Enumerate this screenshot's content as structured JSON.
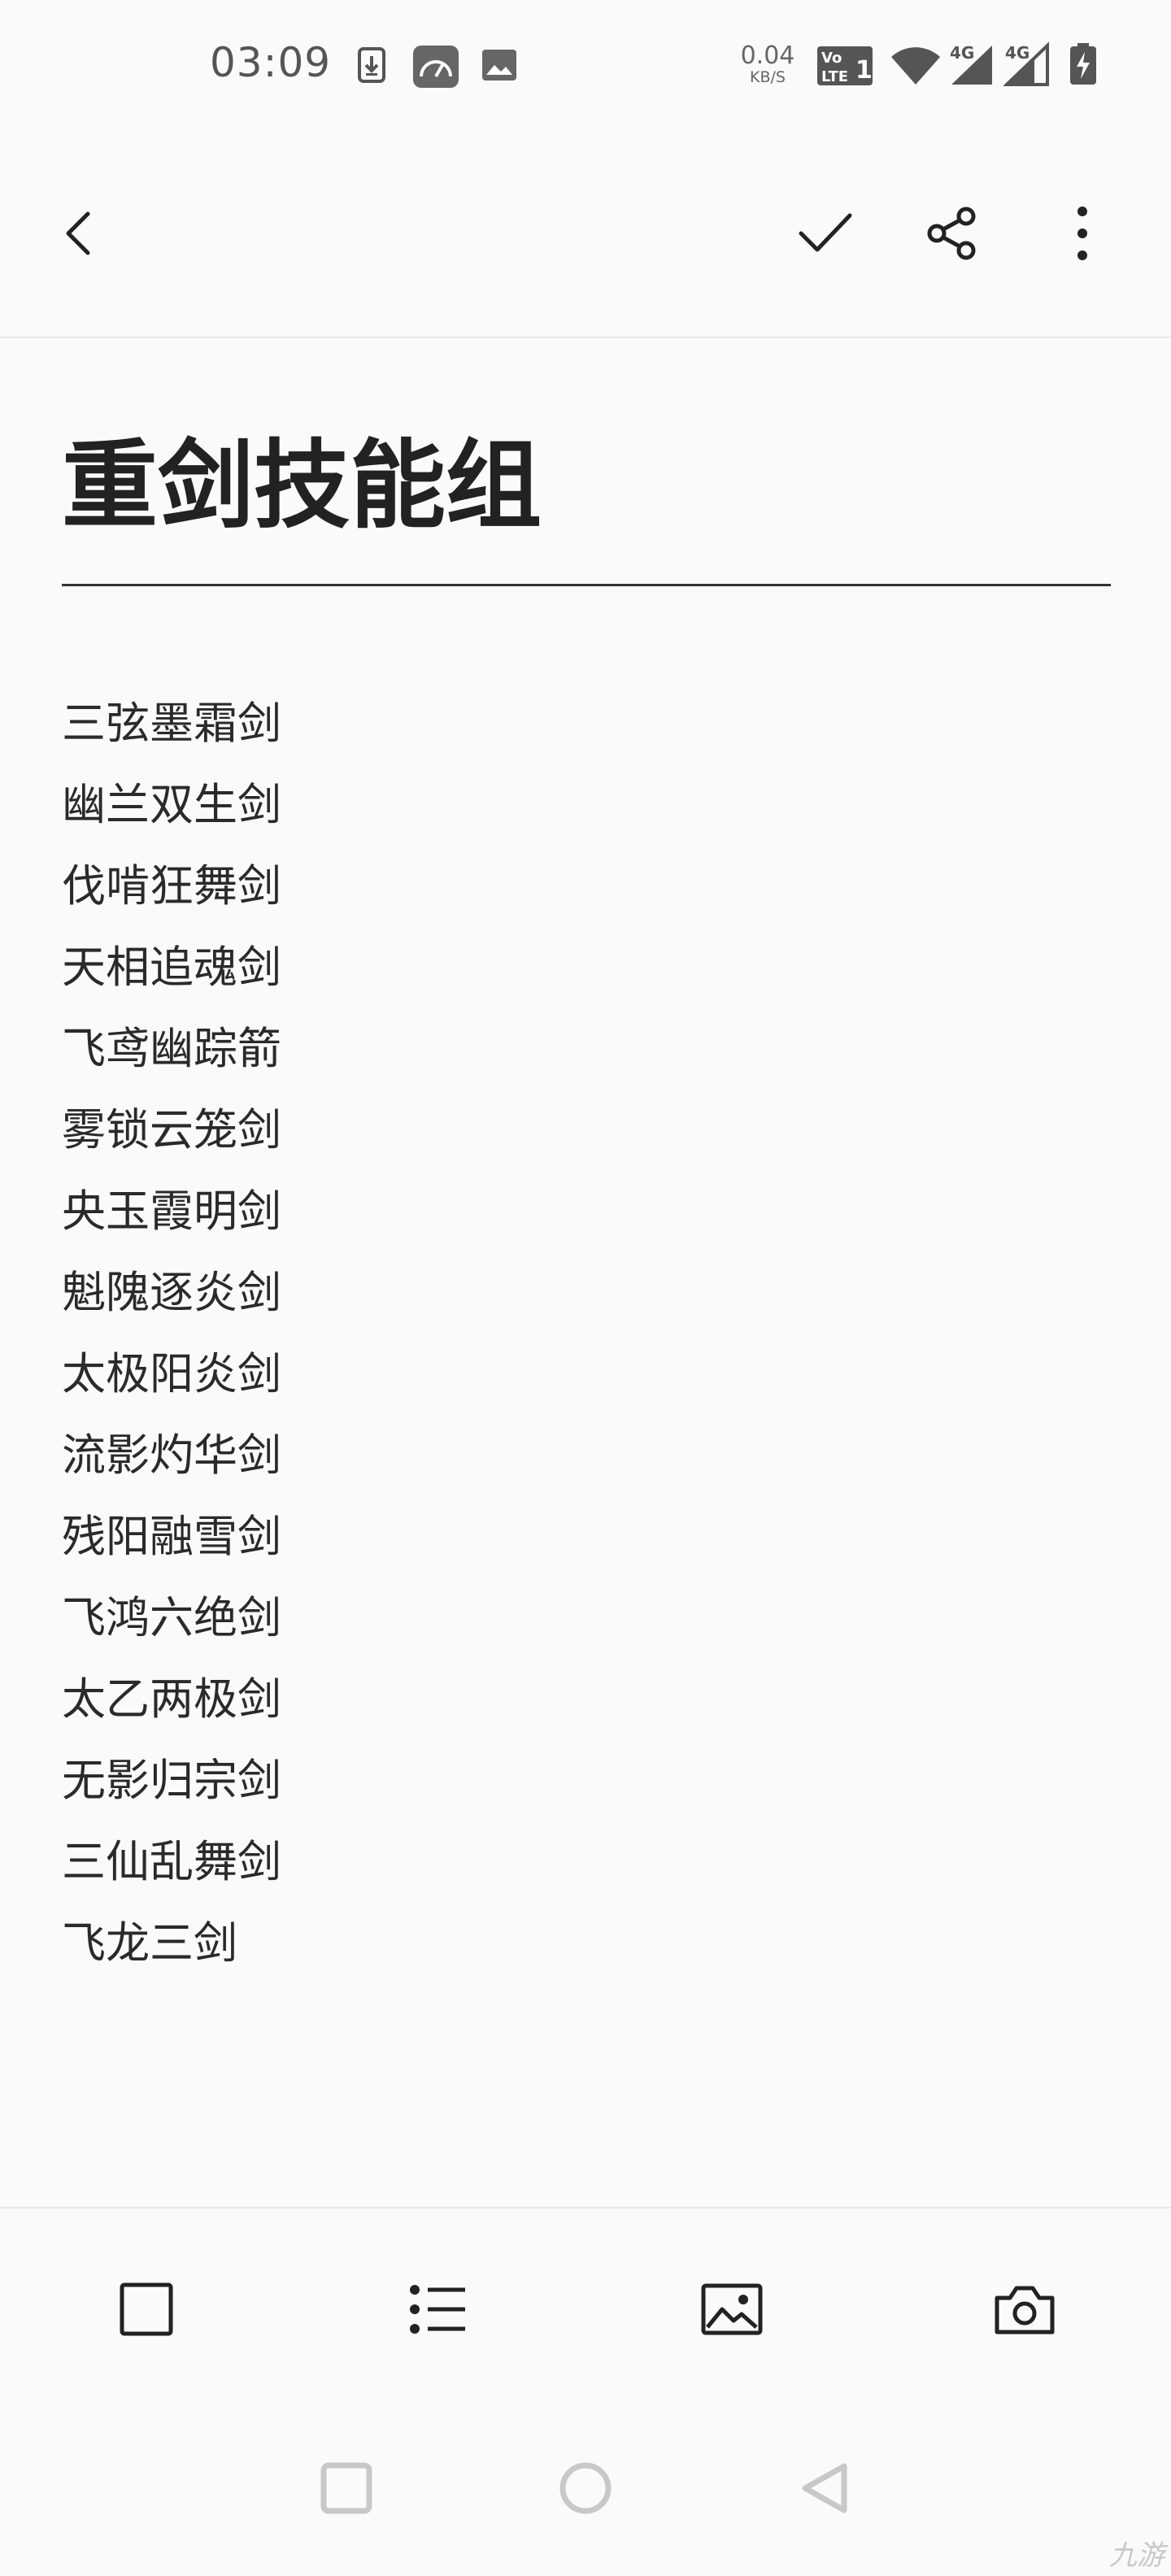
{
  "status_bar": {
    "time": "03:09",
    "net_speed_value": "0.04",
    "net_speed_unit": "KB/S",
    "volte_label": "Vo LTE",
    "signal_1_label": "4G",
    "signal_2_label": "4G",
    "icons": [
      "download-icon",
      "gauge-icon",
      "image-notification-icon",
      "volte-icon",
      "wifi-icon",
      "signal-icon",
      "signal-icon",
      "battery-charging-icon"
    ]
  },
  "toolbar": {
    "icons": [
      "back-icon",
      "check-icon",
      "share-icon",
      "more-vertical-icon"
    ]
  },
  "note": {
    "title": "重剑技能组",
    "lines": [
      "三弦墨霜剑",
      "幽兰双生剑",
      "伐啃狂舞剑",
      "天相追魂剑",
      "飞鸢幽踪箭",
      "雾锁云笼剑",
      "央玉霞明剑",
      "魁隗逐炎剑",
      "太极阳炎剑",
      "流影灼华剑",
      "残阳融雪剑",
      "飞鸿六绝剑",
      "太乙两极剑",
      "无影归宗剑",
      "三仙乱舞剑",
      "飞龙三剑"
    ]
  },
  "bottom_toolbar": {
    "icons": [
      "checkbox-icon",
      "bullet-list-icon",
      "image-icon",
      "camera-icon"
    ]
  },
  "nav_bar": {
    "icons": [
      "recents-square-icon",
      "home-circle-icon",
      "back-triangle-icon"
    ]
  },
  "watermark": "九游"
}
